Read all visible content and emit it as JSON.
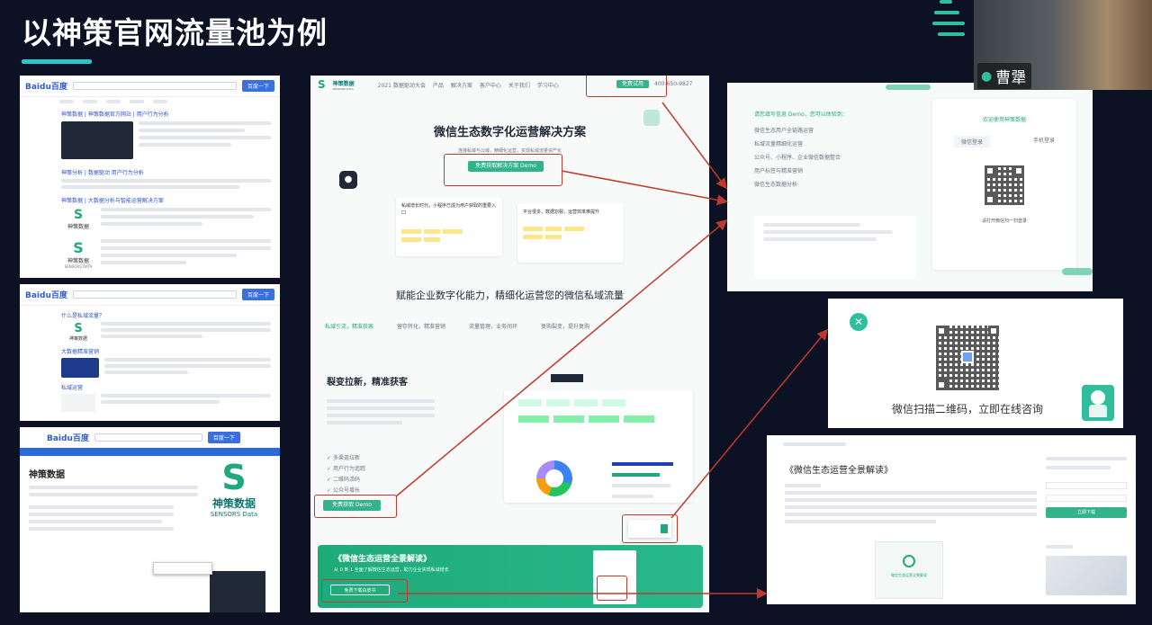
{
  "slide": {
    "title": "以神策官网流量池为例"
  },
  "search_results": {
    "shot1": {
      "logo": "Baidu百度",
      "search_btn": "百度一下",
      "results": [
        "神策数据 | 神策数据官方网站 | 用户行为分析",
        "神策分析 | 数据驱动 用户行为分析",
        "神策数据 | 大数据分析与智能运营解决方案"
      ],
      "brand": "神策数据",
      "brand_sub": "SENSORS DATA"
    },
    "shot2": {
      "logo": "Baidu百度",
      "search_btn": "百度一下",
      "results": [
        "什么是私域流量？",
        "大数据精准营销",
        "私域运营"
      ],
      "brand": "神策数据"
    },
    "shot3": {
      "logo": "Baidu百度",
      "search_btn": "百度一下",
      "page_title": "神策数据",
      "brand": "神策数据",
      "brand_en": "SENSORS Data"
    }
  },
  "landing": {
    "logo_text": "神策数据",
    "logo_sub": "SENSORS DATA",
    "nav": [
      "2021 数据驱动大会",
      "产品",
      "解决方案",
      "客户中心",
      "关于我们",
      "学习中心"
    ],
    "nav_cta": "免费试用",
    "phone": "400-650-9827",
    "hero_title": "微信生态数字化运营解决方案",
    "hero_sub": "连接私域与公域，精细化运营，实现私域流量资产化",
    "hero_btn": "免费获取解决方案 Demo",
    "card1_text": "私域增长时代，小程序已成为用户获取的重要入口",
    "card2_text": "平台很多，数据割裂，运营效率难提升",
    "section_title": "赋能企业数字化能力，精细化运营您的微信私域流量",
    "tabs": [
      "私域引流，精准获客",
      "留存转化，精准营销",
      "流量管理，业务闭环",
      "复购裂变，提升复购"
    ],
    "sub_title": "裂变拉新，精准获客",
    "checks": [
      "多渠道拉新",
      "用户行为追踪",
      "二维码活码",
      "公众号增长"
    ],
    "demo_btn": "免费获取 Demo",
    "banner_title": "《微信生态运营全景解读》",
    "banner_text": "从 0 到 1 全面了解微信生态运营，助力企业实现私域增长",
    "banner_btn": "免费下载白皮书"
  },
  "form_page": {
    "left_title": "请您填写信息 Demo，您可以体验到：",
    "bullets": [
      "微信生态用户全链路运营",
      "私域流量精细化运营",
      "公众号、小程序、企业微信数据整合",
      "用户标签与精准营销",
      "微信生态数据分析"
    ],
    "right_title": "欢迎使用神策数据",
    "tab1": "微信登录",
    "tab2": "手机登录",
    "qr_caption": "请打开微信扫一扫登录"
  },
  "popup": {
    "text": "微信扫描二维码，立即在线咨询"
  },
  "article": {
    "title": "《微信生态运营全景解读》",
    "btn": "立即下载",
    "subtitle": "微信生态运营全景解读"
  },
  "presenter": {
    "name": "曹犟"
  }
}
